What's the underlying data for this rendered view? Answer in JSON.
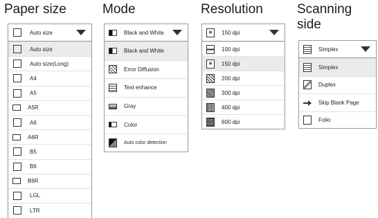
{
  "paper_size": {
    "title": "Paper size",
    "selected": "Auto size",
    "items": [
      {
        "label": "Auto size",
        "icon": "portrait-page-icon",
        "selected": true
      },
      {
        "label": "Auto size(Long)",
        "icon": "portrait-page-icon"
      },
      {
        "label": "A4",
        "icon": "portrait-page-icon"
      },
      {
        "label": "A5",
        "icon": "portrait-page-icon"
      },
      {
        "label": "A5R",
        "icon": "landscape-page-icon"
      },
      {
        "label": "A6",
        "icon": "portrait-page-icon"
      },
      {
        "label": "A6R",
        "icon": "landscape-page-icon"
      },
      {
        "label": "B5",
        "icon": "portrait-page-icon"
      },
      {
        "label": "B6",
        "icon": "portrait-page-icon"
      },
      {
        "label": "B6R",
        "icon": "landscape-page-icon"
      },
      {
        "label": "LGL",
        "icon": "portrait-page-icon"
      },
      {
        "label": "LTR",
        "icon": "portrait-page-icon"
      }
    ]
  },
  "mode": {
    "title": "Mode",
    "selected": "Black and White",
    "items": [
      {
        "label": "Black and White",
        "icon": "black-and-white-icon",
        "selected": true
      },
      {
        "label": "Error Diffusion",
        "icon": "error-diffusion-icon"
      },
      {
        "label": "Text enhance",
        "icon": "text-enhance-icon"
      },
      {
        "label": "Gray",
        "icon": "gray-icon"
      },
      {
        "label": "Color",
        "icon": "color-icon"
      },
      {
        "label": "Auto color detection",
        "icon": "auto-color-icon"
      }
    ]
  },
  "resolution": {
    "title": "Resolution",
    "selected": "150 dpi",
    "items": [
      {
        "label": "100 dpi",
        "icon": "dpi-100-icon"
      },
      {
        "label": "150 dpi",
        "icon": "dpi-150-icon",
        "selected": true
      },
      {
        "label": "200 dpi",
        "icon": "dpi-200-icon"
      },
      {
        "label": "300 dpi",
        "icon": "dpi-300-icon"
      },
      {
        "label": "400 dpi",
        "icon": "dpi-400-icon"
      },
      {
        "label": "600 dpi",
        "icon": "dpi-600-icon"
      }
    ]
  },
  "scanning_side": {
    "title_line1": "Scanning",
    "title_line2": "side",
    "selected": "Simplex",
    "items": [
      {
        "label": "Simplex",
        "icon": "simplex-icon",
        "selected": true
      },
      {
        "label": "Duplex",
        "icon": "duplex-icon"
      },
      {
        "label": "Skip Blank Page",
        "icon": "skip-blank-page-icon"
      },
      {
        "label": "Folio",
        "icon": "folio-icon"
      }
    ]
  }
}
